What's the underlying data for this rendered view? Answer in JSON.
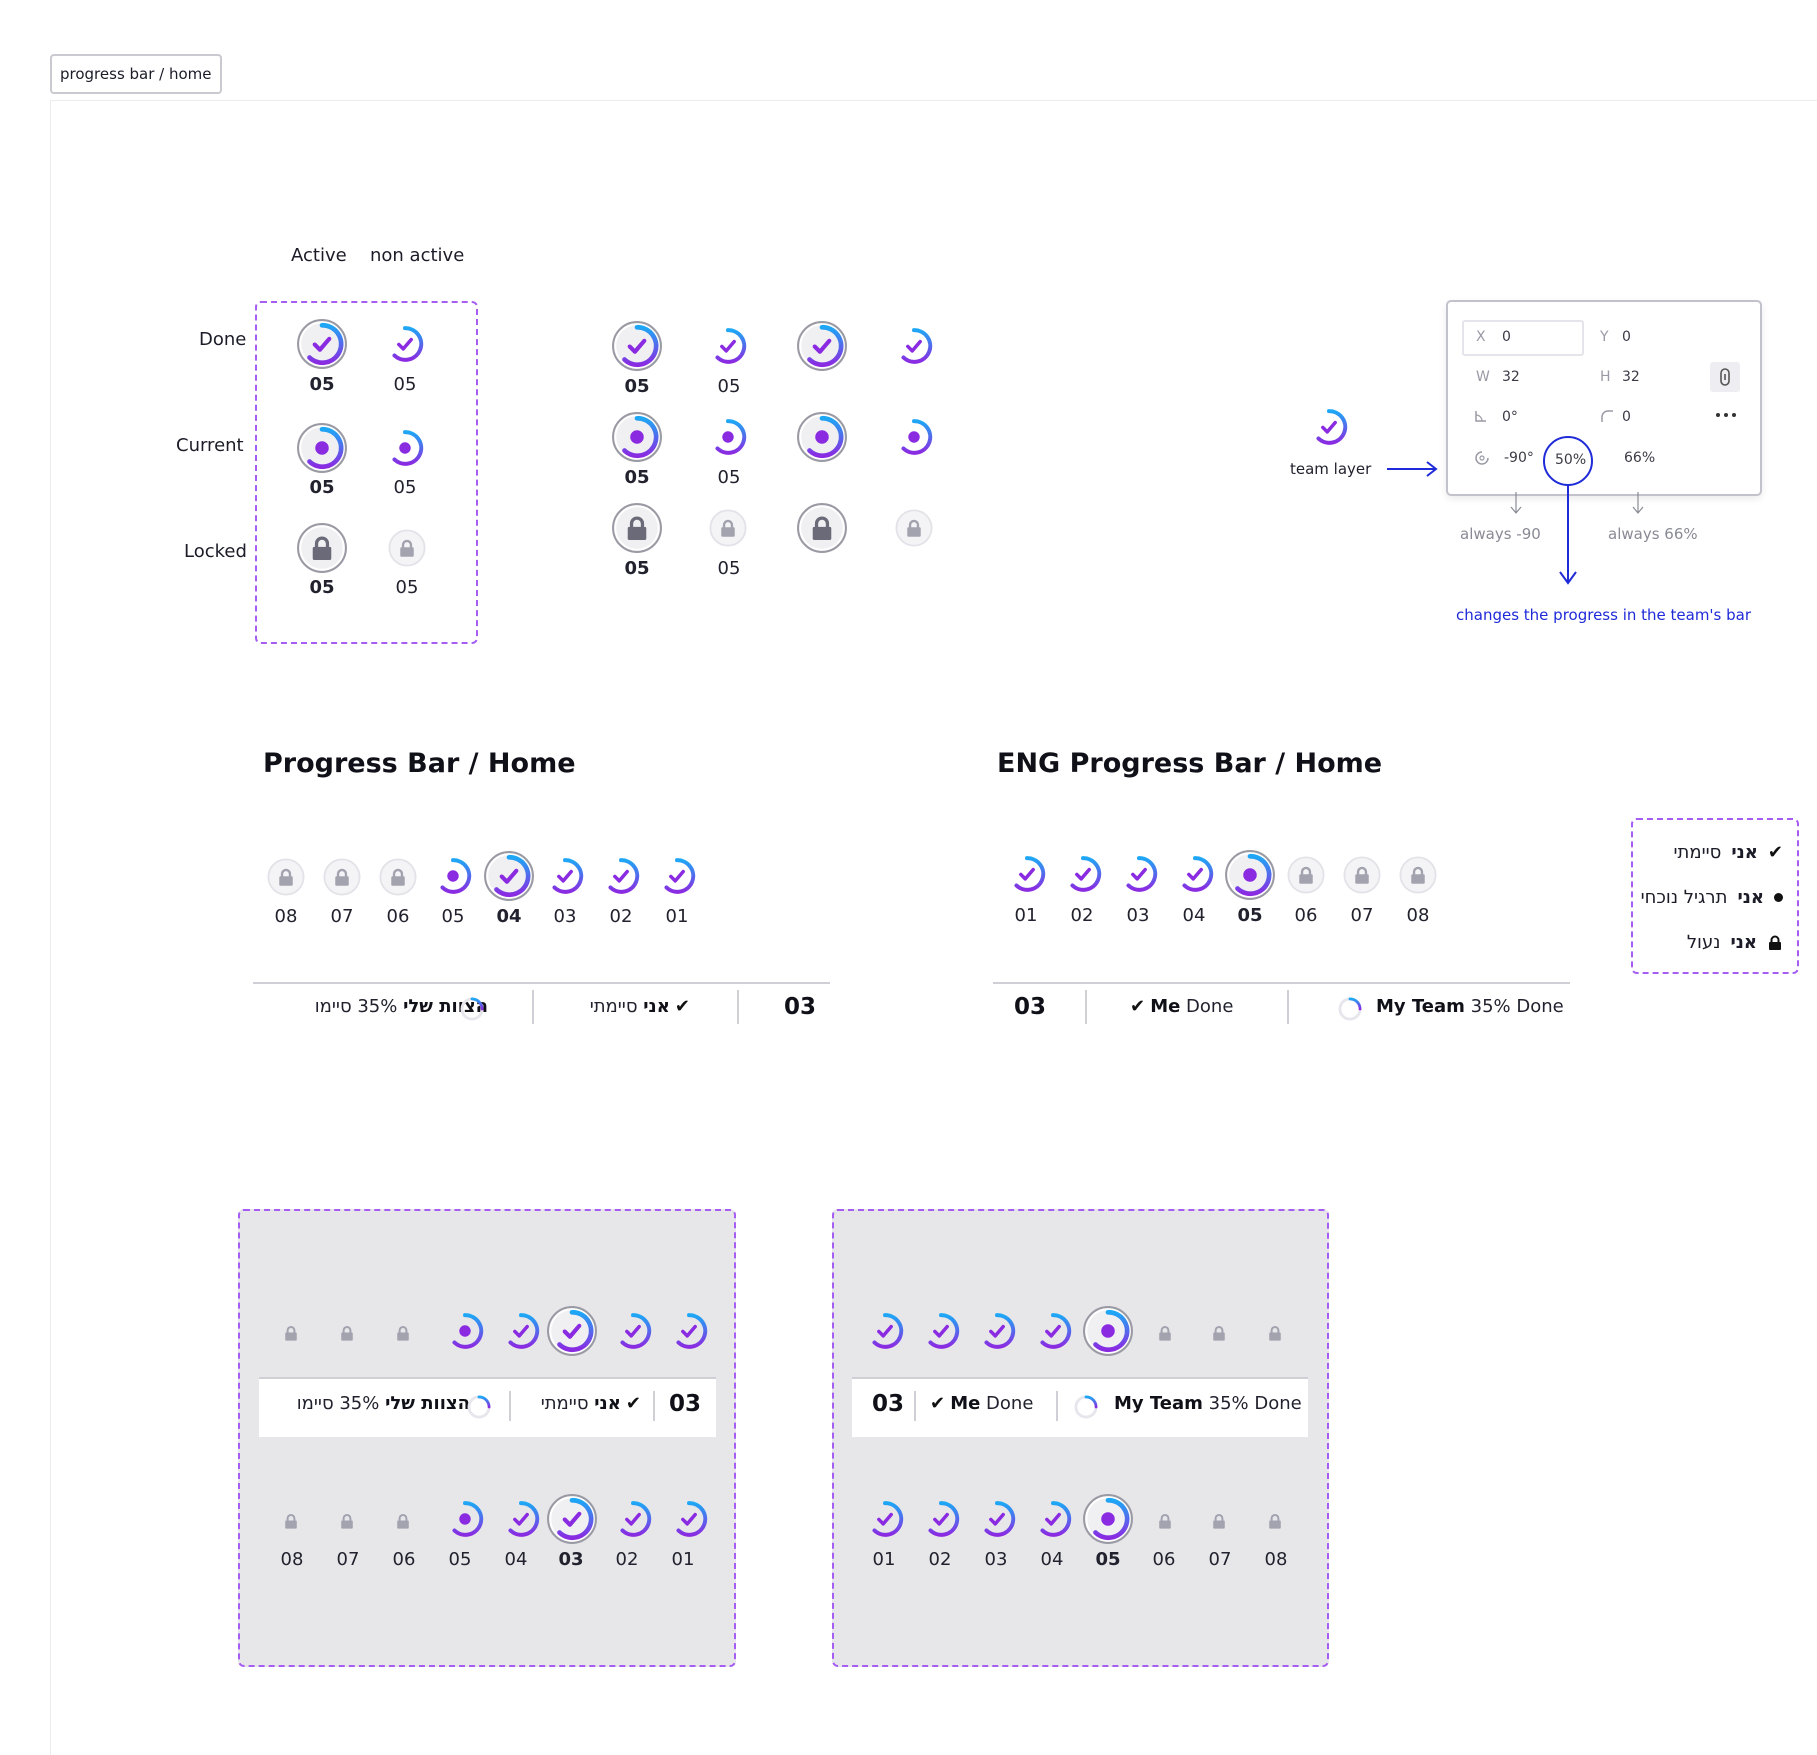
{
  "frame_tag": "progress bar / home",
  "states": {
    "col_active": "Active",
    "col_non_active": "non active",
    "row_done": "Done",
    "row_current": "Current",
    "row_locked": "Locked",
    "label": "05"
  },
  "team_layer": {
    "label": "team layer",
    "props": {
      "x_key": "X",
      "x_val": "0",
      "y_key": "Y",
      "y_val": "0",
      "w_key": "W",
      "w_val": "32",
      "h_key": "H",
      "h_val": "32",
      "rot_val": "0°",
      "radius_val": "0",
      "start_val": "-90°",
      "sweep_val": "50%",
      "ratio_val": "66%"
    },
    "note_start": "always -90",
    "note_ratio": "always 66%",
    "note_sweep": "changes the progress in the team's bar"
  },
  "heb": {
    "title": "Progress Bar / Home",
    "steps": [
      "08",
      "07",
      "06",
      "05",
      "04",
      "03",
      "02",
      "01"
    ],
    "count": "03",
    "me_done": "סיימתי",
    "me_label": "אני",
    "team_label": "הצוות שלי",
    "team_done": "35% סיימו"
  },
  "eng": {
    "title": "ENG Progress Bar / Home",
    "steps": [
      "01",
      "02",
      "03",
      "04",
      "05",
      "06",
      "07",
      "08"
    ],
    "count": "03",
    "me_label": "Me",
    "me_done": "Done",
    "team_label": "My Team",
    "team_done": "35% Done"
  },
  "legend": {
    "row1_bold": "אני",
    "row1_text": "סיימתי",
    "row2_bold": "אני",
    "row2_text": "תרגיל נוכחי",
    "row3_bold": "אני",
    "row3_text": "נעול"
  },
  "panel_heb": {
    "steps": [
      "08",
      "07",
      "06",
      "05",
      "04",
      "03",
      "02",
      "01"
    ],
    "count": "03"
  },
  "panel_eng": {
    "steps": [
      "01",
      "02",
      "03",
      "04",
      "05",
      "06",
      "07",
      "08"
    ],
    "count": "03"
  },
  "colors": {
    "purple": "#8a2be2",
    "blue": "#1ea7f5",
    "locked_gray": "#a3a3b0",
    "dashed_border": "#a65df2",
    "annotation_blue": "#1f2bd8"
  },
  "icons": [
    "check-icon",
    "dot-icon",
    "lock-icon",
    "arrow-right-icon",
    "arrow-down-icon",
    "more-icon",
    "link-icon"
  ]
}
